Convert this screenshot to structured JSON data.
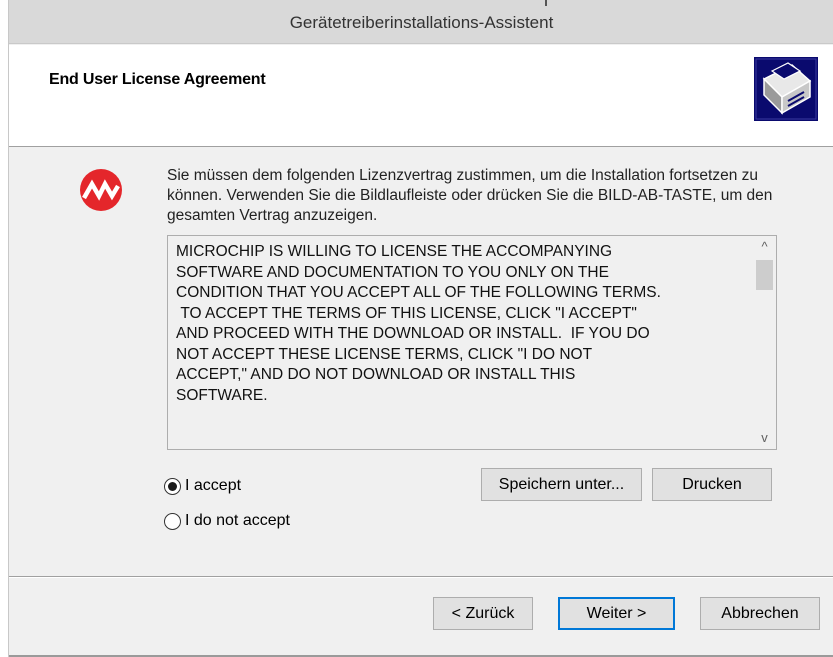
{
  "window": {
    "title": "Gerätetreiberinstallations-Assistent"
  },
  "header": {
    "heading": "End User License Agreement",
    "icon": "setup-wizard-icon"
  },
  "intro": {
    "logo": "microchip-logo-icon",
    "text": "Sie müssen dem folgenden Lizenzvertrag zustimmen, um die Installation fortsetzen zu können. Verwenden Sie die Bildlaufleiste oder drücken Sie die BILD-AB-TASTE, um den gesamten Vertrag anzuzeigen."
  },
  "license": {
    "text": "MICROCHIP IS WILLING TO LICENSE THE ACCOMPANYING\nSOFTWARE AND DOCUMENTATION TO YOU ONLY ON THE\nCONDITION THAT YOU ACCEPT ALL OF THE FOLLOWING TERMS.\n TO ACCEPT THE TERMS OF THIS LICENSE, CLICK \"I ACCEPT\"\nAND PROCEED WITH THE DOWNLOAD OR INSTALL.  IF YOU DO\nNOT ACCEPT THESE LICENSE TERMS, CLICK \"I DO NOT\nACCEPT,\" AND DO NOT DOWNLOAD OR INSTALL THIS\nSOFTWARE.",
    "scroll_up": "^",
    "scroll_down": "v"
  },
  "options": {
    "accept_label": "I accept",
    "decline_label": "I do not accept",
    "selected": "accept"
  },
  "actions": {
    "save_label": "Speichern unter...",
    "print_label": "Drucken"
  },
  "footer": {
    "back_label": "< Zurück",
    "next_label": "Weiter >",
    "cancel_label": "Abbrechen"
  },
  "colors": {
    "logo_red": "#e4262b",
    "icon_navy": "#0a0a6e",
    "focus_blue": "#0078d7"
  }
}
